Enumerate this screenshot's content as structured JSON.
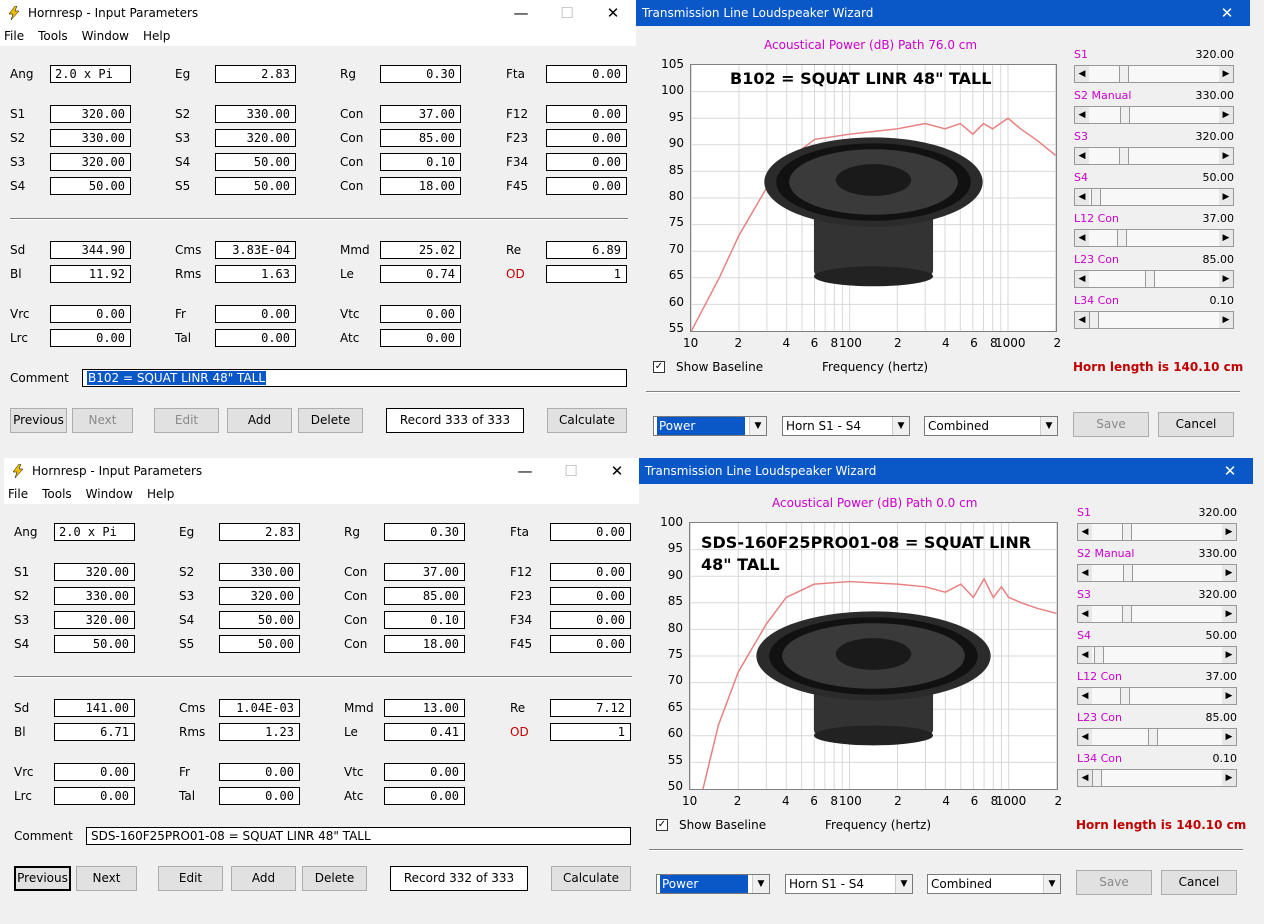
{
  "win1": {
    "title": "Hornresp - Input Parameters",
    "menu": [
      "File",
      "Tools",
      "Window",
      "Help"
    ],
    "ang": "2.0 x Pi",
    "eg": "2.83",
    "rg": "0.30",
    "fta": "0.00",
    "s1a": "320.00",
    "s2a": "330.00",
    "con12": "37.00",
    "f12": "0.00",
    "s2b": "330.00",
    "s3b": "320.00",
    "con23": "85.00",
    "f23": "0.00",
    "s3c": "320.00",
    "s4c": "50.00",
    "con34": "0.10",
    "f34": "0.00",
    "s4d": "50.00",
    "s5d": "50.00",
    "con45": "18.00",
    "f45": "0.00",
    "sd": "344.90",
    "cms": "3.83E-04",
    "mmd": "25.02",
    "re": "6.89",
    "bl": "11.92",
    "rms": "1.63",
    "le": "0.74",
    "od": "1",
    "vrc": "0.00",
    "fr": "0.00",
    "vtc": "0.00",
    "lrc": "0.00",
    "tal": "0.00",
    "atc": "0.00",
    "comment": "B102 = SQUAT LINR   48\" TALL",
    "record": "Record 333 of 333"
  },
  "win2": {
    "title": "Hornresp - Input Parameters",
    "menu": [
      "File",
      "Tools",
      "Window",
      "Help"
    ],
    "ang": "2.0 x Pi",
    "eg": "2.83",
    "rg": "0.30",
    "fta": "0.00",
    "s1a": "320.00",
    "s2a": "330.00",
    "con12": "37.00",
    "f12": "0.00",
    "s2b": "330.00",
    "s3b": "320.00",
    "con23": "85.00",
    "f23": "0.00",
    "s3c": "320.00",
    "s4c": "50.00",
    "con34": "0.10",
    "f34": "0.00",
    "s4d": "50.00",
    "s5d": "50.00",
    "con45": "18.00",
    "f45": "0.00",
    "sd": "141.00",
    "cms": "1.04E-03",
    "mmd": "13.00",
    "re": "7.12",
    "bl": "6.71",
    "rms": "1.23",
    "le": "0.41",
    "od": "1",
    "vrc": "0.00",
    "fr": "0.00",
    "vtc": "0.00",
    "lrc": "0.00",
    "tal": "0.00",
    "atc": "0.00",
    "comment": "SDS-160F25PRO01-08 = SQUAT LINR   48\" TALL",
    "record": "Record 332 of 333"
  },
  "labels": {
    "ang": "Ang",
    "eg": "Eg",
    "rg": "Rg",
    "fta": "Fta",
    "s1": "S1",
    "s2": "S2",
    "s3": "S3",
    "s4": "S4",
    "s5": "S5",
    "con": "Con",
    "f12": "F12",
    "f23": "F23",
    "f34": "F34",
    "f45": "F45",
    "sd": "Sd",
    "cms": "Cms",
    "mmd": "Mmd",
    "re": "Re",
    "bl": "Bl",
    "rms": "Rms",
    "le": "Le",
    "od": "OD",
    "vrc": "Vrc",
    "fr": "Fr",
    "vtc": "Vtc",
    "lrc": "Lrc",
    "tal": "Tal",
    "atc": "Atc",
    "comment": "Comment"
  },
  "buttons": {
    "previous": "Previous",
    "next": "Next",
    "edit": "Edit",
    "add": "Add",
    "delete": "Delete",
    "calculate": "Calculate",
    "save": "Save",
    "cancel": "Cancel"
  },
  "wiz1": {
    "title": "Transmission Line Loudspeaker Wizard",
    "header": "Acoustical Power (dB)   Path 76.0 cm",
    "speaker": "B102 = SQUAT LINR   48\" TALL",
    "yticks": [
      "105",
      "100",
      "95",
      "90",
      "85",
      "80",
      "75",
      "70",
      "65",
      "60",
      "55"
    ],
    "horn_length": "Horn length is 140.10 cm"
  },
  "wiz2": {
    "title": "Transmission Line Loudspeaker Wizard",
    "header": "Acoustical Power (dB)   Path 0.0 cm",
    "speaker_line1": "SDS-160F25PRO01-08 = SQUAT LINR",
    "speaker_line2": "48\" TALL",
    "yticks": [
      "100",
      "95",
      "90",
      "85",
      "80",
      "75",
      "70",
      "65",
      "60",
      "55",
      "50"
    ],
    "horn_length": "Horn length is 140.10 cm"
  },
  "wizard": {
    "xticks": [
      "10",
      "2",
      "4",
      "6",
      "8",
      "100",
      "2",
      "4",
      "6",
      "8",
      "1000",
      "2"
    ],
    "xlabel": "Frequency (hertz)",
    "show_baseline": "Show Baseline",
    "combo_power": "Power",
    "combo_horn": "Horn S1 - S4",
    "combo_combined": "Combined",
    "sliders": [
      {
        "label": "S1",
        "value": "320.00",
        "pos": 0.25
      },
      {
        "label": "S2 Manual",
        "value": "330.00",
        "pos": 0.26
      },
      {
        "label": "S3",
        "value": "320.00",
        "pos": 0.25
      },
      {
        "label": "S4",
        "value": "50.00",
        "pos": 0.02
      },
      {
        "label": "L12 Con",
        "value": "37.00",
        "pos": 0.23
      },
      {
        "label": "L23 Con",
        "value": "85.00",
        "pos": 0.47
      },
      {
        "label": "L34 Con",
        "value": "0.10",
        "pos": 0.0
      }
    ]
  },
  "colors": {
    "title_blue": "#0a58c8",
    "magenta": "#cc00cc",
    "curve": "#e88080",
    "od_red": "#c00000"
  }
}
